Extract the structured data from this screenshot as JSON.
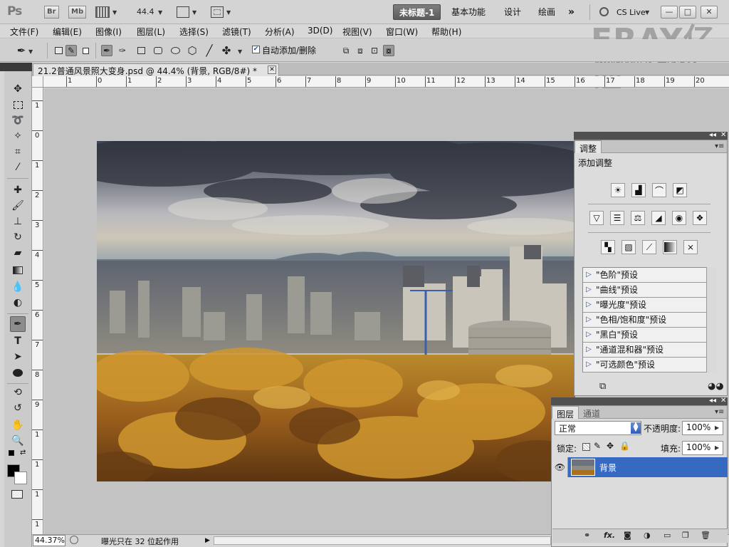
{
  "appbar": {
    "logo": "Ps",
    "bridge": "Br",
    "minibridge": "Mb",
    "zoom": "44.4",
    "workspaces": [
      "未标题-1",
      "基本功能",
      "设计",
      "绘画"
    ],
    "more": "»",
    "cs_live": "CS Live",
    "window_buttons": [
      "—",
      "□",
      "✕"
    ]
  },
  "watermark": {
    "brand": "ERAY亿瑞",
    "studio": "DESIGN STUDIO",
    "line": "视频版权所有 盗用必究"
  },
  "menu": [
    "文件(F)",
    "编辑(E)",
    "图像(I)",
    "图层(L)",
    "选择(S)",
    "滤镜(T)",
    "分析(A)",
    "3D(D)",
    "视图(V)",
    "窗口(W)",
    "帮助(H)"
  ],
  "options": {
    "auto_add_delete": "自动添加/删除",
    "auto_add_checked": "✔"
  },
  "document": {
    "tab_title": "21.2普通风景照大变身.psd @ 44.4% (背景, RGB/8#) *",
    "close": "✕"
  },
  "rulers": {
    "h_ticks": [
      "1",
      "0",
      "1",
      "2",
      "3",
      "4",
      "5",
      "6",
      "7",
      "8",
      "9",
      "10",
      "11",
      "12",
      "13",
      "14",
      "15",
      "16",
      "17",
      "18",
      "19",
      "20"
    ],
    "v_ticks": [
      "1",
      "0",
      "1",
      "2",
      "3",
      "4",
      "5",
      "6",
      "7",
      "8",
      "9",
      "1",
      "1",
      "1",
      "1",
      "1"
    ]
  },
  "status": {
    "zoom": "44.37%",
    "text": "曝光只在 32 位起作用"
  },
  "adjustments": {
    "tab": "调整",
    "title": "添加调整",
    "presets": [
      "\"色阶\"预设",
      "\"曲线\"预设",
      "\"曝光度\"预设",
      "\"色相/饱和度\"预设",
      "\"黑白\"预设",
      "\"通道混和器\"预设",
      "\"可选颜色\"预设"
    ]
  },
  "layers": {
    "tabs": [
      "图层",
      "通道"
    ],
    "blend_mode": "正常",
    "opacity_label": "不透明度:",
    "opacity": "100%",
    "lock_label": "锁定:",
    "fill_label": "填充:",
    "fill": "100%",
    "layer_name": "背景"
  },
  "colors": {
    "workspace_bg": "#c3c3c3",
    "selected_layer": "#3569c2",
    "panel_bg": "#dcdcdc"
  }
}
